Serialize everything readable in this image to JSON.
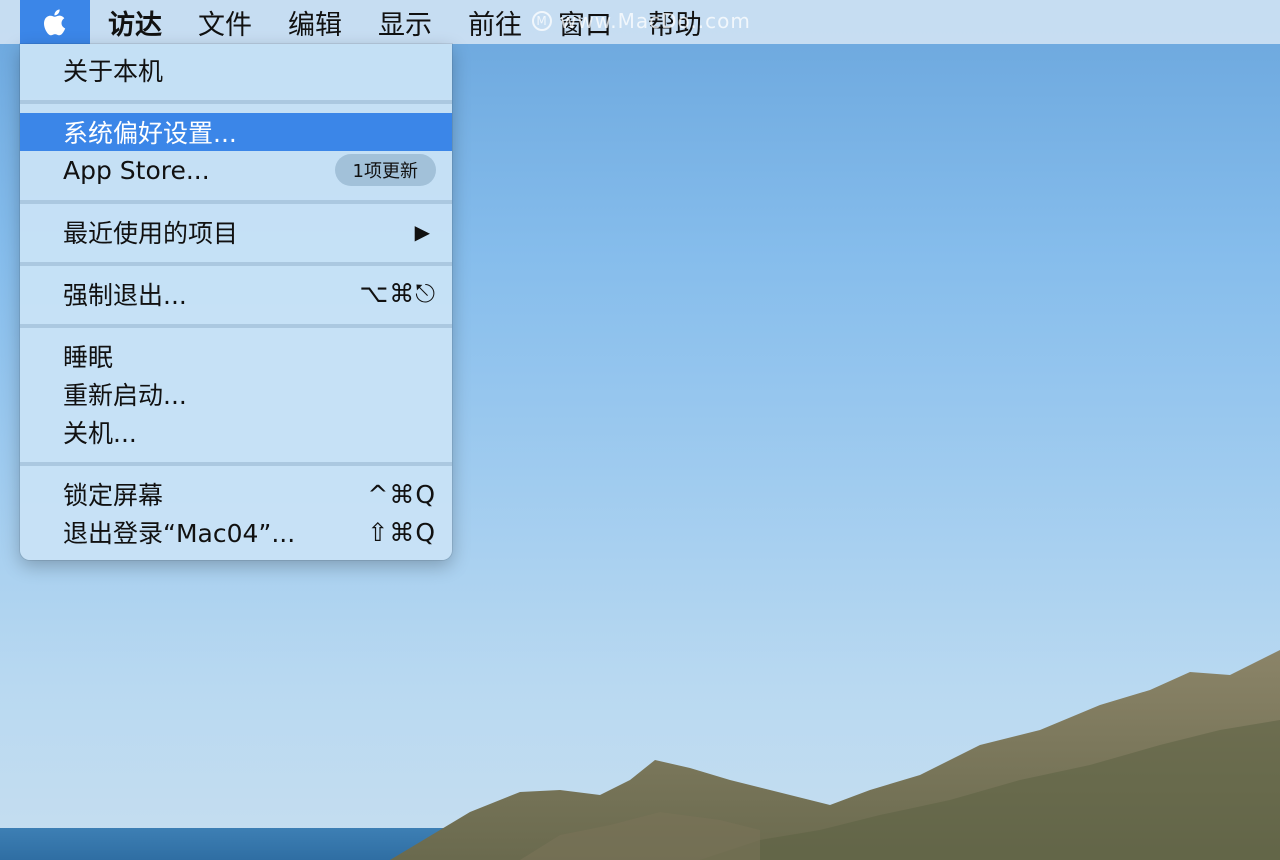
{
  "menubar": {
    "apple_icon": "apple-logo-icon",
    "items": [
      {
        "label": "访达",
        "bold": true
      },
      {
        "label": "文件"
      },
      {
        "label": "编辑"
      },
      {
        "label": "显示"
      },
      {
        "label": "前往"
      },
      {
        "label": "窗口"
      },
      {
        "label": "帮助"
      }
    ],
    "watermark": "www.MacDo..com",
    "watermark_glyph": "M"
  },
  "apple_menu": {
    "about": "关于本机",
    "system_prefs": "系统偏好设置...",
    "app_store": "App Store...",
    "app_store_badge": "1项更新",
    "recent_items": "最近使用的项目",
    "recent_arrow": "▶",
    "force_quit": "强制退出...",
    "force_quit_shortcut": "⌥⌘⎋",
    "sleep": "睡眠",
    "restart": "重新启动...",
    "shutdown": "关机...",
    "lock_screen": "锁定屏幕",
    "lock_screen_shortcut": "^⌘Q",
    "logout": "退出登录“Mac04”...",
    "logout_shortcut": "⇧⌘Q"
  },
  "colors": {
    "highlight": "#3b86e8",
    "menu_bg": "#c8e2f6",
    "menubar_bg": "#cee2f3"
  }
}
